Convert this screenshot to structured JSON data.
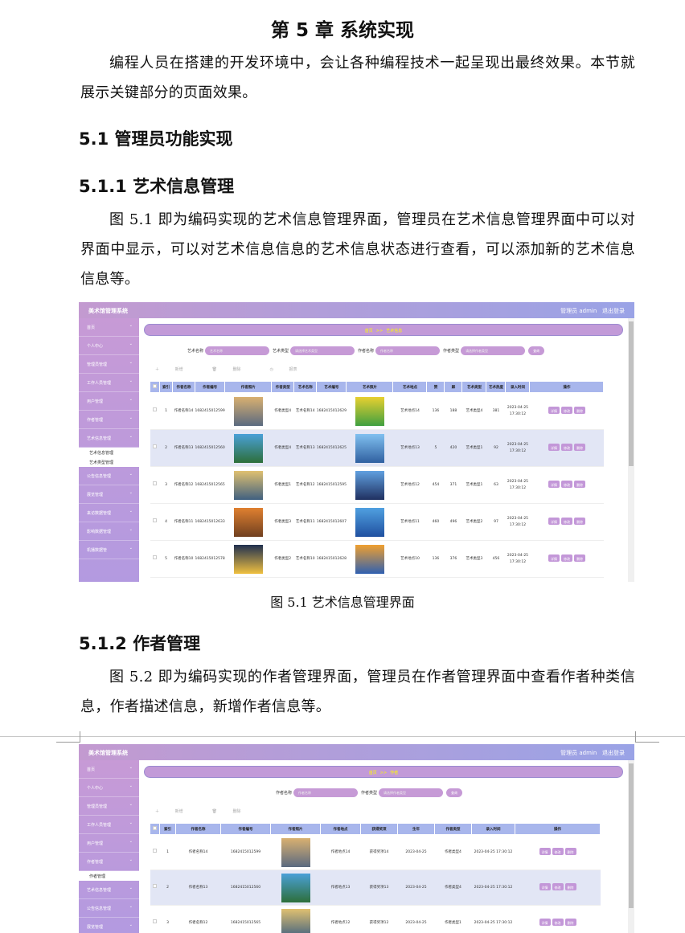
{
  "chapter_title": "第 5 章  系统实现",
  "intro": "编程人员在搭建的开发环境中，会让各种编程技术一起呈现出最终效果。本节就展示关键部分的页面效果。",
  "sec_5_1": "5.1  管理员功能实现",
  "sec_5_1_1": "5.1.1  艺术信息管理",
  "para_5_1_1": "图 5.1 即为编码实现的艺术信息管理界面，管理员在艺术信息管理界面中可以对界面中显示，可以对艺术信息信息的艺术信息状态进行查看，可以添加新的艺术信息信息等。",
  "caption_5_1": "图 5.1 艺术信息管理界面",
  "sec_5_1_2": "5.1.2  作者管理",
  "para_5_1_2": "图 5.2 即为编码实现的作者管理界面，管理员在作者管理界面中查看作者种类信息，作者描述信息，新增作者信息等。",
  "app": {
    "title": "美术馆管理系统",
    "user": "管理员 admin",
    "logout": "退出登录",
    "home": "首页",
    "arrow": ">>"
  },
  "shot1": {
    "sidebar": [
      "首页",
      "个人中心",
      "管理员管理",
      "工作人员管理",
      "用户管理",
      "作者管理",
      "艺术信息管理"
    ],
    "sub_items": [
      "艺术信息管理",
      "艺术类型管理"
    ],
    "sidebar_after": [
      "公告信息管理",
      "展览管理",
      "来访数据管理",
      "影响数据管理",
      "机播数据管"
    ],
    "crumb": "艺术信息",
    "search_labels": [
      "艺术名称",
      "艺术类型",
      "作者名称",
      "作者类型"
    ],
    "search_placeholders": [
      "艺术名称",
      "请选择艺术类型",
      "作者名称",
      "请选择作者类型"
    ],
    "search_btn": "查询",
    "actions": [
      "新增",
      "删除",
      "报表"
    ],
    "headers": [
      "索引",
      "作者名称",
      "作者编号",
      "作者照片",
      "作者类型",
      "艺术名称",
      "艺术编号",
      "艺术照片",
      "艺术地点",
      "赞",
      "踩",
      "艺术类型",
      "艺术热度",
      "录入时间",
      "操作"
    ],
    "row_ops": [
      "详情",
      "修改",
      "删除"
    ],
    "rows": [
      [
        "1",
        "作者名称14",
        "1682415012599",
        "作者类型4",
        "艺术名称14",
        "1682415012629",
        "艺术地点14",
        "136",
        "188",
        "艺术类型4",
        "381",
        "2023-04-25 17:30:12"
      ],
      [
        "2",
        "作者名称13",
        "1682415012560",
        "作者类型4",
        "艺术名称13",
        "1682415012625",
        "艺术地点13",
        "5",
        "420",
        "艺术类型1",
        "92",
        "2023-04-25 17:30:12"
      ],
      [
        "3",
        "作者名称12",
        "1682415012565",
        "作者类型1",
        "艺术名称12",
        "1682415012595",
        "艺术地点12",
        "454",
        "371",
        "艺术类型1",
        "63",
        "2023-04-25 17:30:12"
      ],
      [
        "4",
        "作者名称11",
        "1682415012633",
        "作者类型3",
        "艺术名称11",
        "1682415012607",
        "艺术地点11",
        "460",
        "496",
        "艺术类型2",
        "97",
        "2023-04-25 17:30:12"
      ],
      [
        "5",
        "作者名称10",
        "1682415012578",
        "作者类型2",
        "艺术名称10",
        "1682415012628",
        "艺术地点10",
        "136",
        "376",
        "艺术类型3",
        "456",
        "2023-04-25 17:30:12"
      ]
    ]
  },
  "shot2": {
    "sidebar": [
      "首页",
      "个人中心",
      "管理员管理",
      "工作人员管理",
      "用户管理",
      "作者管理"
    ],
    "sub_items": [
      "作者管理"
    ],
    "sidebar_after": [
      "艺术信息管理",
      "公告信息管理",
      "展览管理"
    ],
    "crumb": "作者",
    "search_labels": [
      "作者名称",
      "作者类型"
    ],
    "search_placeholders": [
      "作者名称",
      "请选择作者类型"
    ],
    "search_btn": "查询",
    "actions": [
      "新增",
      "删除"
    ],
    "headers": [
      "索引",
      "作者名称",
      "作者编号",
      "作者照片",
      "作者地点",
      "获得奖项",
      "生年",
      "作者类型",
      "录入时间",
      "操作"
    ],
    "row_ops": [
      "详情",
      "修改",
      "删除"
    ],
    "rows": [
      [
        "1",
        "作者名称14",
        "1682415012599",
        "作者地点14",
        "获得奖项14",
        "2023-04-25",
        "作者类型4",
        "2023-04-25 17:30:12"
      ],
      [
        "2",
        "作者名称13",
        "1682415012560",
        "作者地点13",
        "获得奖项13",
        "2023-04-25",
        "作者类型4",
        "2023-04-25 17:30:12"
      ],
      [
        "3",
        "作者名称12",
        "1682415012565",
        "作者地点12",
        "获得奖项12",
        "2023-04-25",
        "作者类型1",
        "2023-04-25 17:30:12"
      ]
    ]
  }
}
